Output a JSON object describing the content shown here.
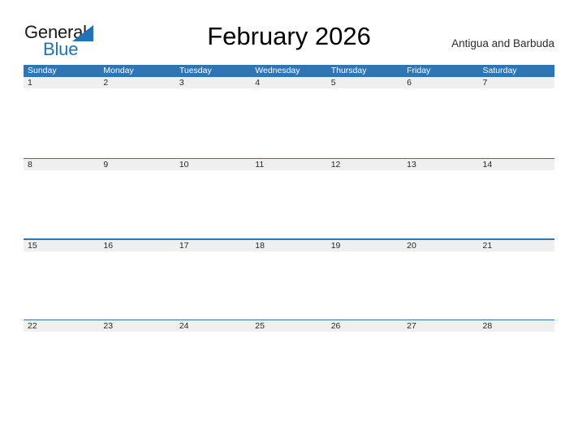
{
  "header": {
    "logo": {
      "text_primary": "General",
      "text_secondary": "Blue",
      "primary_color": "#1a1a1a",
      "accent_color": "#2272b9"
    },
    "title": "February 2026",
    "region": "Antigua and Barbuda"
  },
  "calendar": {
    "accent_color": "#2e75b6",
    "number_band_color": "#efefef",
    "weekdays": [
      "Sunday",
      "Monday",
      "Tuesday",
      "Wednesday",
      "Thursday",
      "Friday",
      "Saturday"
    ],
    "weeks": [
      {
        "days": [
          "1",
          "2",
          "3",
          "4",
          "5",
          "6",
          "7"
        ]
      },
      {
        "days": [
          "8",
          "9",
          "10",
          "11",
          "12",
          "13",
          "14"
        ]
      },
      {
        "days": [
          "15",
          "16",
          "17",
          "18",
          "19",
          "20",
          "21"
        ]
      },
      {
        "days": [
          "22",
          "23",
          "24",
          "25",
          "26",
          "27",
          "28"
        ]
      }
    ]
  }
}
